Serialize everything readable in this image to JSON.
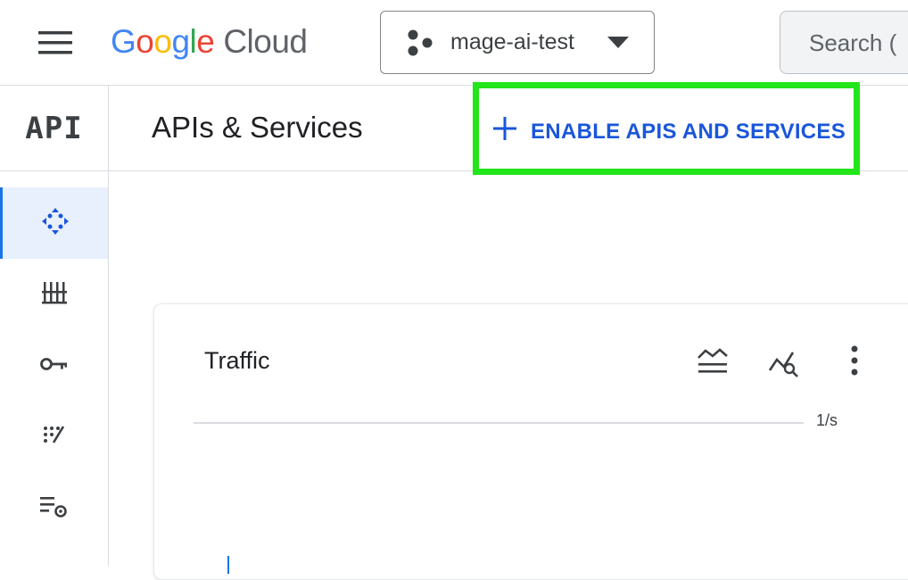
{
  "header": {
    "brand_google": "Google",
    "brand_cloud": "Cloud",
    "project_name": "mage-ai-test",
    "search_placeholder": "Search ("
  },
  "rail": {
    "title": "API",
    "items": [
      {
        "icon": "dashboard-icon",
        "active": true
      },
      {
        "icon": "library-icon",
        "active": false
      },
      {
        "icon": "key-icon",
        "active": false
      },
      {
        "icon": "oauth-consent-icon",
        "active": false
      },
      {
        "icon": "settings-list-icon",
        "active": false
      }
    ]
  },
  "page": {
    "title": "APIs & Services",
    "enable_button_label": "ENABLE APIS AND SERVICES"
  },
  "traffic_card": {
    "title": "Traffic",
    "axis_unit": "1/s"
  },
  "colors": {
    "accent_blue": "#1a56db",
    "highlight_green": "#22e51a",
    "active_bg": "#e8f0fe"
  }
}
